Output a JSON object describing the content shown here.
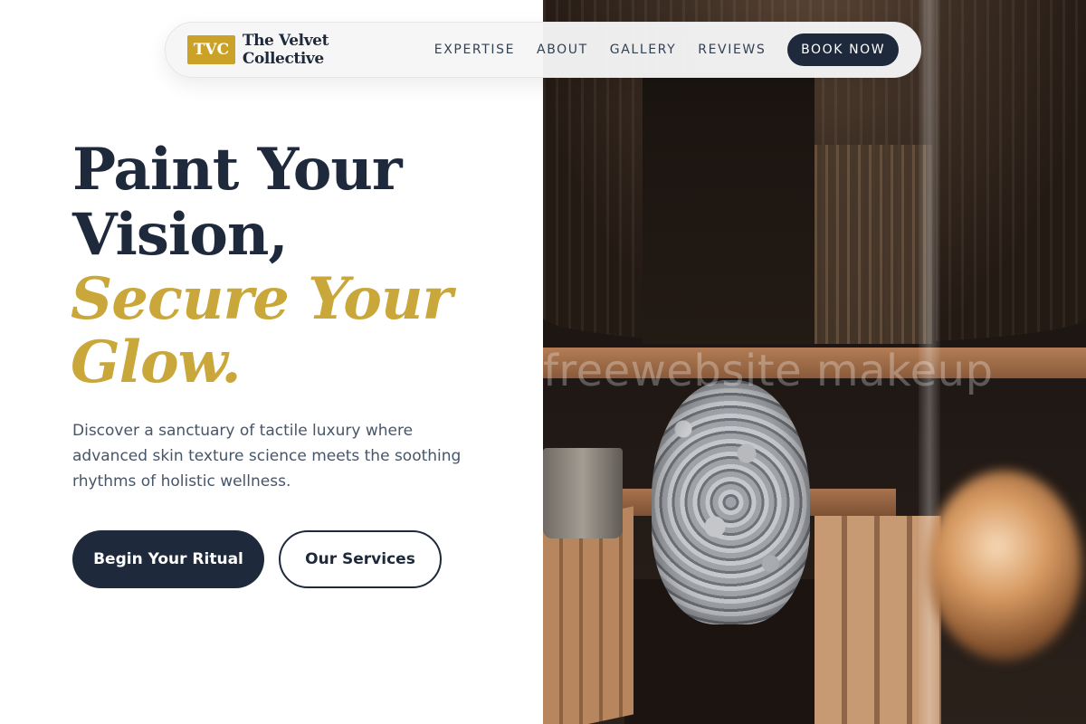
{
  "brand": {
    "mark": "TVC",
    "name": "The Velvet Collective",
    "accent_color": "#c9a227",
    "dark_color": "#1e293b"
  },
  "nav": {
    "links": [
      {
        "label": "EXPERTISE"
      },
      {
        "label": "ABOUT"
      },
      {
        "label": "GALLERY"
      },
      {
        "label": "REVIEWS"
      }
    ],
    "cta": "BOOK NOW"
  },
  "hero": {
    "title_lines": [
      "Paint Your",
      "Vision,"
    ],
    "accent_lines": [
      "Secure Your",
      "Glow."
    ],
    "description": "Discover a sanctuary of tactile luxury where advanced skin texture science meets the soothing rhythms of holistic wellness.",
    "primary_button": "Begin Your Ritual",
    "secondary_button": "Our Services"
  },
  "image": {
    "watermark": "freewebsite makeup"
  }
}
